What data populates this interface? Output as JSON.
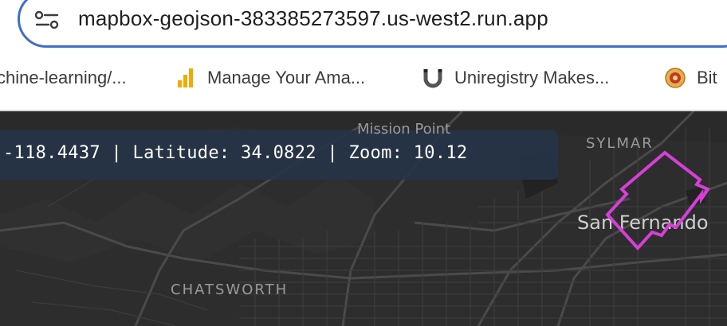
{
  "browser": {
    "url": "mapbox-geojson-383385273597.us-west2.run.app",
    "bookmarks": [
      {
        "label": "chine-learning/...",
        "icon": "none"
      },
      {
        "label": "Manage Your Ama...",
        "icon": "bar-chart-icon"
      },
      {
        "label": "Uniregistry Makes...",
        "icon": "magnet-icon"
      },
      {
        "label": "Bit",
        "icon": "bitcoin-coin-icon"
      }
    ]
  },
  "map": {
    "coord_readout": "-118.4437 | Latitude: 34.0822 | Zoom: 10.12",
    "longitude": -118.4437,
    "latitude": 34.0822,
    "zoom": 10.12,
    "labels": {
      "mission_point": "Mission Point",
      "sylmar": "SYLMAR",
      "san_fernando": "San Fernando",
      "chatsworth": "CHATSWORTH"
    },
    "polygon_color": "#d63fd6"
  }
}
